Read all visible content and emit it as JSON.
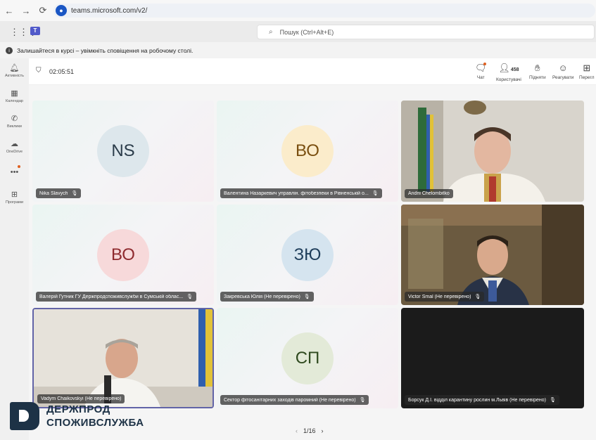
{
  "browser": {
    "back": "←",
    "forward": "→",
    "reload": "⟳",
    "url": "teams.microsoft.com/v2/"
  },
  "teams": {
    "logo_letter": "T",
    "search_placeholder": "Пошук (Ctrl+Alt+E)",
    "notice": "Залишайтеся в курсі – увімкніть сповіщення на робочому столі."
  },
  "rail": [
    {
      "icon": "bell-icon",
      "label": "Активність"
    },
    {
      "icon": "calendar-icon",
      "label": "Календар"
    },
    {
      "icon": "phone-icon",
      "label": "Виклики"
    },
    {
      "icon": "cloud-icon",
      "label": "OneDrive"
    },
    {
      "icon": "more-icon",
      "label": ""
    },
    {
      "icon": "add-app-icon",
      "label": "Програми"
    }
  ],
  "meeting": {
    "timer": "02:05:51",
    "controls": {
      "chat": "Чат",
      "people": "Користувачі",
      "people_count": "458",
      "raise": "Підняти",
      "react": "Реагувати",
      "view": "Перегл"
    },
    "tiles": [
      {
        "name": "Nika Slavych",
        "initials": "NS",
        "avatar_bg": "#dde7ec",
        "avatar_fg": "#2b3c4a"
      },
      {
        "name": "Валентина Назаркевич управлін. фітобезпеки в Рівненській о...",
        "initials": "ВО",
        "avatar_bg": "#fbeccb",
        "avatar_fg": "#7a4f10"
      },
      {
        "name": "Andrii Chelombitko"
      },
      {
        "name": "Валерій Гутник ГУ Держпродспоживслужби в Сумській облас...",
        "initials": "ВО",
        "avatar_bg": "#f7d9da",
        "avatar_fg": "#8e2a2e"
      },
      {
        "name": "Закревська Юлія (Не перевірено)",
        "initials": "ЗЮ",
        "avatar_bg": "#d5e4ef",
        "avatar_fg": "#1f3e5b"
      },
      {
        "name": "Victor Smal (Не перевірено)"
      },
      {
        "name": "Vadym Chaikovskyi (Не перевірено)"
      },
      {
        "name": "Сектор фітосанітарних заходів паромний (Не перевірено)",
        "initials": "СП",
        "avatar_bg": "#e3ead8",
        "avatar_fg": "#2f4a1f"
      },
      {
        "name": "Борсук Д.І. відділ карантину рослин м.Львів (Не перевірено)"
      }
    ],
    "pager": "1/16"
  },
  "logo": {
    "line1": "ДЕРЖПРОД",
    "line2": "СПОЖИВСЛУЖБА"
  },
  "colors": {
    "accent": "#6264a7",
    "logo": "#1d3246"
  }
}
